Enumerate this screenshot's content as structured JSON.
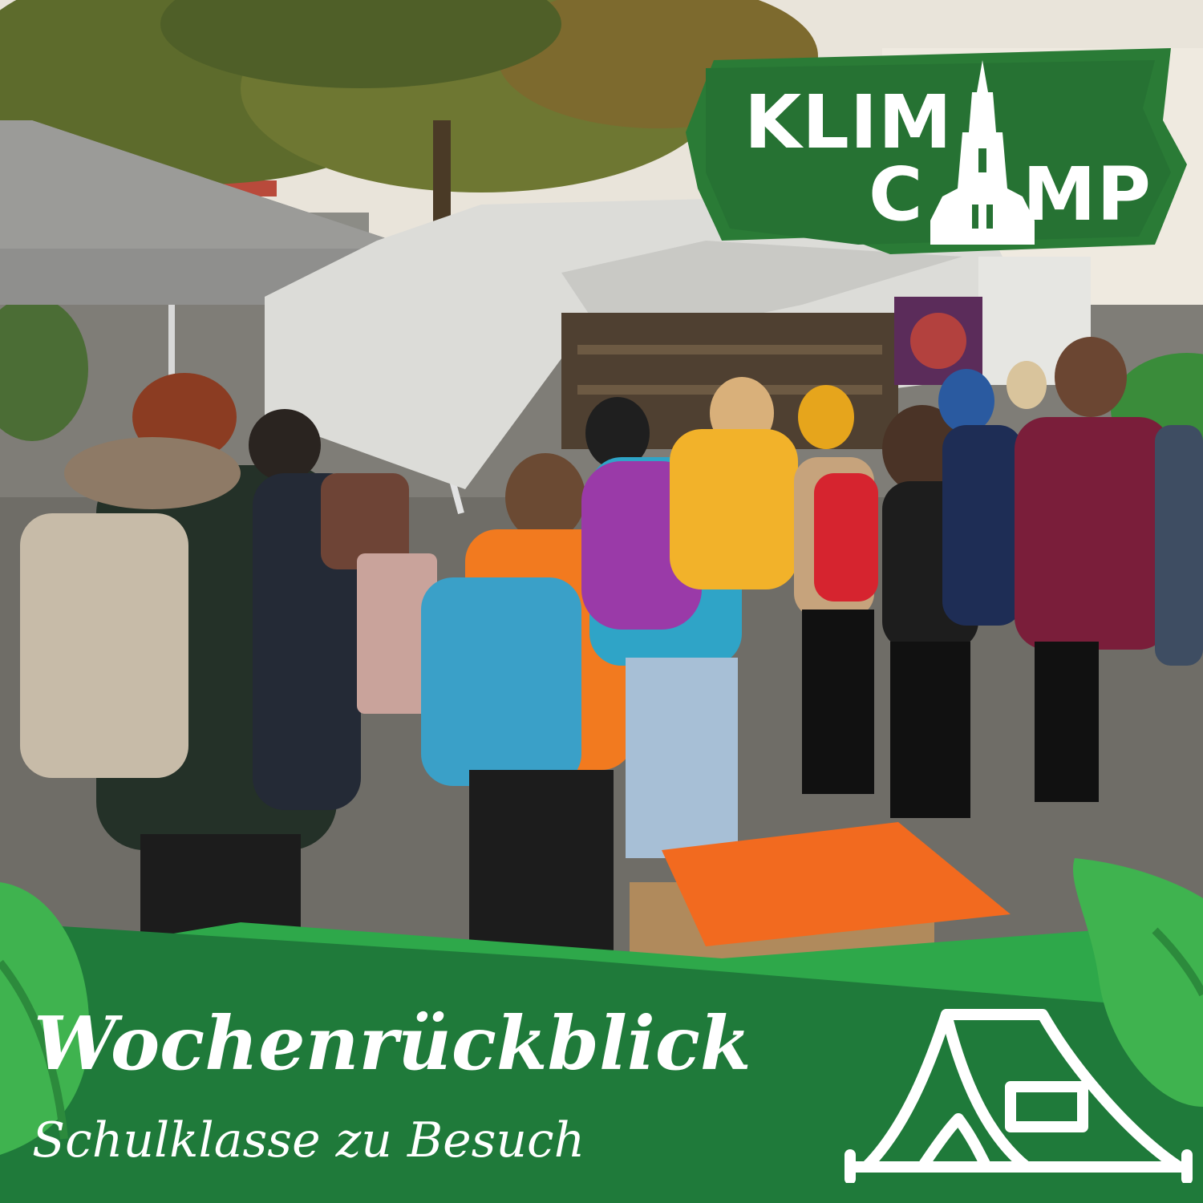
{
  "logo": {
    "line1": "KLIM",
    "line2_left": "C",
    "line2_right": "MP",
    "icon": "cathedral-icon"
  },
  "banner": {
    "title": "Wochenrückblick",
    "subtitle": "Schulklasse zu Besuch",
    "icon": "tent-icon"
  },
  "colors": {
    "banner_dark_green": "#1f7a3a",
    "banner_green": "#2ea84a",
    "leaf_green": "#3fb34f",
    "text": "#ffffff"
  }
}
